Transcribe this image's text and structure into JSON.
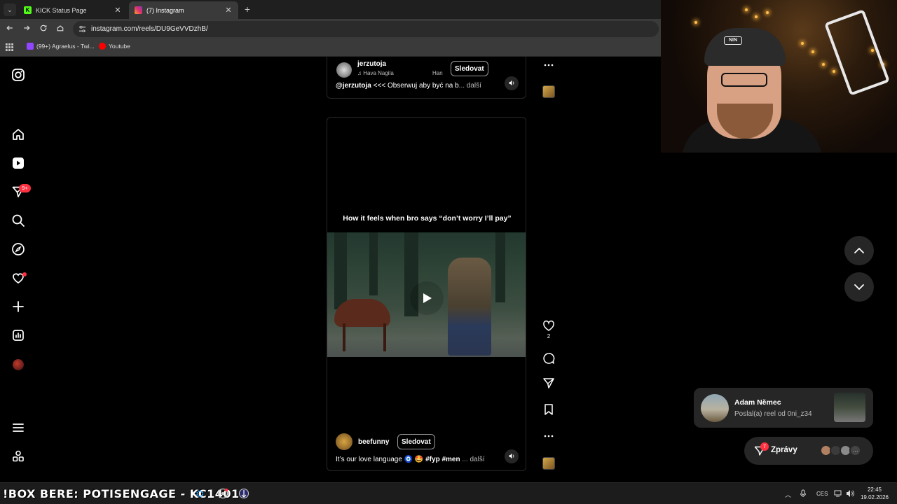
{
  "browser": {
    "tabs": [
      {
        "label": "KICK Status Page",
        "favicon": "kick-icon"
      },
      {
        "label": "(7) Instagram",
        "favicon": "instagram-icon",
        "active": true
      }
    ],
    "url": "instagram.com/reels/DU9GeVVDzhB/",
    "bookmarks": [
      {
        "label": "(99+) Agraelus - Twi...",
        "icon": "twitch-icon"
      },
      {
        "label": "Youtube",
        "icon": "youtube-icon"
      }
    ]
  },
  "sidebar": {
    "messages_badge": "9+"
  },
  "reel_top": {
    "username": "jerzutoja",
    "music": "Hava Nagila",
    "music_extra": "Han",
    "follow_label": "Sledovat",
    "caption_user": "@jerzutoja",
    "caption_text": " <<< Obserwuj aby być na b",
    "caption_more": "... další"
  },
  "reel_main": {
    "video_caption": "How it feels when bro says “don’t worry I’ll pay”",
    "username": "beefunny",
    "follow_label": "Sledovat",
    "caption_text": "It’s our love language 🧿 🤩 ",
    "caption_tags": "#fyp #men",
    "caption_more": " ... další",
    "likes": "2"
  },
  "notification": {
    "name": "Adam Němec",
    "message": "Poslal(a) reel od 0ni_z34"
  },
  "messages": {
    "label": "Zprávy",
    "badge": "7",
    "more": "···"
  },
  "taskbar": {
    "marquee": "!BOX BERE: POTISENGAGE - KC1401",
    "lang": "CES",
    "time": "22:45",
    "date": "19.02.2026"
  },
  "colors": {
    "accent_red": "#ff3040",
    "card_bg": "#262626",
    "kick_green": "#53fc18"
  }
}
